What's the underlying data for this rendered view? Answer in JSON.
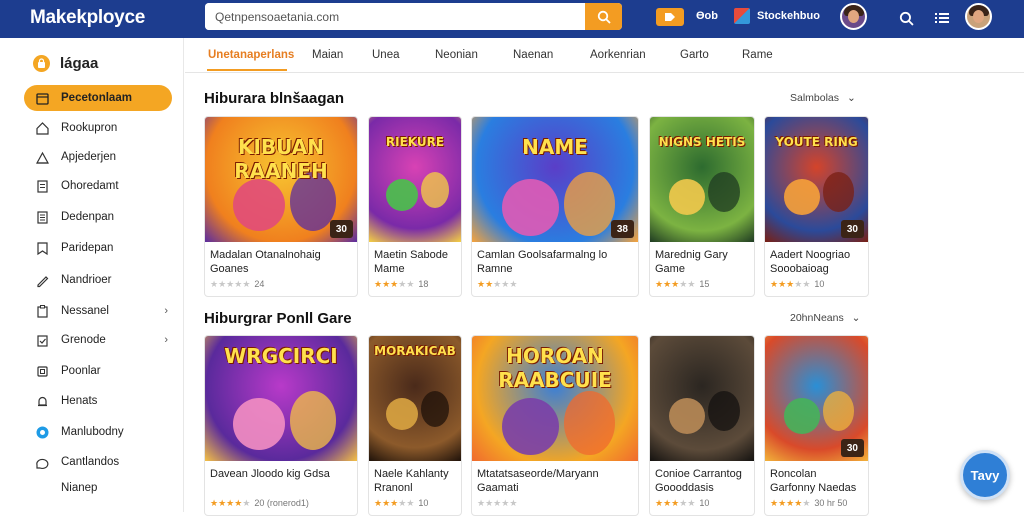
{
  "header": {
    "logo": "Makekployce",
    "search_value": "Qetnpensoaetania.com",
    "nav_text_1": "Ɵob",
    "nav_text_2": "Stockehbuo",
    "icons": [
      "search-icon",
      "menu-icon",
      "avatar"
    ]
  },
  "sidebar": {
    "title": "lágaa",
    "items": [
      {
        "label": "Pecetonlaam",
        "icon": "home-icon",
        "active": true
      },
      {
        "label": "Rookupron",
        "icon": "house-outline-icon"
      },
      {
        "label": "Apjederjen",
        "icon": "triangle-house-icon"
      },
      {
        "label": "Ohoredamt",
        "icon": "document-icon"
      },
      {
        "label": "Dedenpan",
        "icon": "document-lines-icon"
      },
      {
        "label": "Paridepan",
        "icon": "bookmark-icon"
      },
      {
        "label": "Nandrioer",
        "icon": "pen-icon"
      },
      {
        "label": "Nessanel",
        "icon": "clipboard-icon",
        "chevron": true
      },
      {
        "label": "Grenode",
        "icon": "check-clipboard-icon",
        "chevron": true
      },
      {
        "label": "Poonlar",
        "icon": "file-icon"
      },
      {
        "label": "Henats",
        "icon": "bell-icon"
      },
      {
        "label": "Manlubodny",
        "icon": "blue-circle-icon"
      },
      {
        "label": "Cantlandos",
        "icon": "chat-icon"
      },
      {
        "label": "Nianep",
        "icon": ""
      }
    ]
  },
  "tabs": [
    "Unetanaperlans",
    "Maian",
    "Unea",
    "Neonian",
    "Naenan",
    "Aorkenrian",
    "Garto",
    "Rame"
  ],
  "sections": [
    {
      "title": "Hiburara blnšaagan",
      "more": "Salmbolas",
      "cards": [
        {
          "art": "KIBUAN RAANEH",
          "name": "Madalan Otanalnohaig Goanes",
          "rating": 0,
          "count": "24",
          "price": "30",
          "theme": "yellow"
        },
        {
          "art": "RIEKURE",
          "name": "Maetin Sabode Mame",
          "rating": 3,
          "count": "18",
          "price": "",
          "theme": "pink"
        },
        {
          "art": "NAME",
          "name": "Camlan Goolsafarmalng lo Ramne",
          "rating": 2,
          "count": "",
          "price": "38",
          "theme": "purple"
        },
        {
          "art": "NIGNS HETIS",
          "name": "Marednig Gary Game",
          "rating": 3,
          "count": "15",
          "price": "",
          "theme": "green"
        },
        {
          "art": "YOUTE RING",
          "name": "Aadert Noogriao Sooobaioag",
          "rating": 3,
          "count": "10",
          "price": "30",
          "theme": "red"
        }
      ]
    },
    {
      "title": "Hiburgrar Ponll Gare",
      "more": "20hnNeans",
      "cards": [
        {
          "art": "WRGCIRCI",
          "name": "Davean Jloodo kig Gdsa",
          "rating": 4,
          "count": "20 (ronerod1)",
          "price": "",
          "theme": "magenta"
        },
        {
          "art": "MORAKICAB",
          "name": "Naele Kahlanty Rranonl",
          "rating": 3,
          "count": "10",
          "price": "",
          "theme": "brown"
        },
        {
          "art": "HOROAN RAABCUIE",
          "name": "Mtatatsaseorde/Maryann Gaamati",
          "rating": 0,
          "count": "",
          "price": "",
          "theme": "orange"
        },
        {
          "art": "",
          "name": "Conioe Carrantog Goooddasis",
          "rating": 3,
          "count": "10",
          "price": "",
          "theme": "dark"
        },
        {
          "art": "",
          "name": "Roncolan Garfonny Naedas",
          "rating": 4,
          "count": "30 hr 50",
          "price": "30",
          "theme": "teal"
        }
      ]
    }
  ],
  "fab_label": "Tavy",
  "colors": {
    "header": "#1d3d8f",
    "accent": "#f39c22",
    "fab": "#2f7fd6"
  }
}
